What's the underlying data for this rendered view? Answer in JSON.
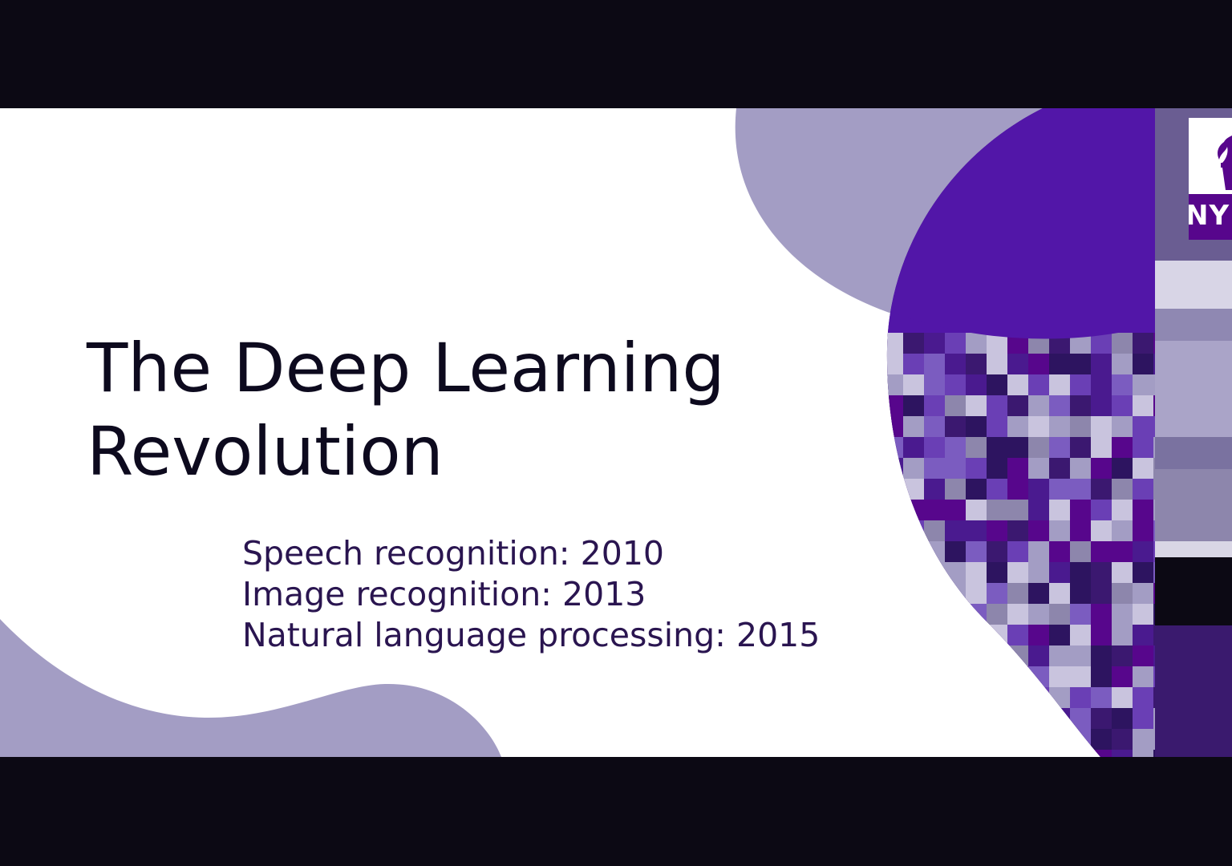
{
  "slide": {
    "title_line1": "The Deep Learning",
    "title_line2": "Revolution",
    "bullets": [
      "Speech recognition: 2010",
      "Image recognition: 2013",
      "Natural language processing: 2015"
    ]
  },
  "logo": {
    "text": "NY",
    "icon": "torch-icon"
  },
  "colors": {
    "brand_purple": "#57068c",
    "lavender": "#a39dc4",
    "letterbox": "#0c0914",
    "title_text": "#0d0a1e",
    "bullet_text": "#2a1550"
  }
}
